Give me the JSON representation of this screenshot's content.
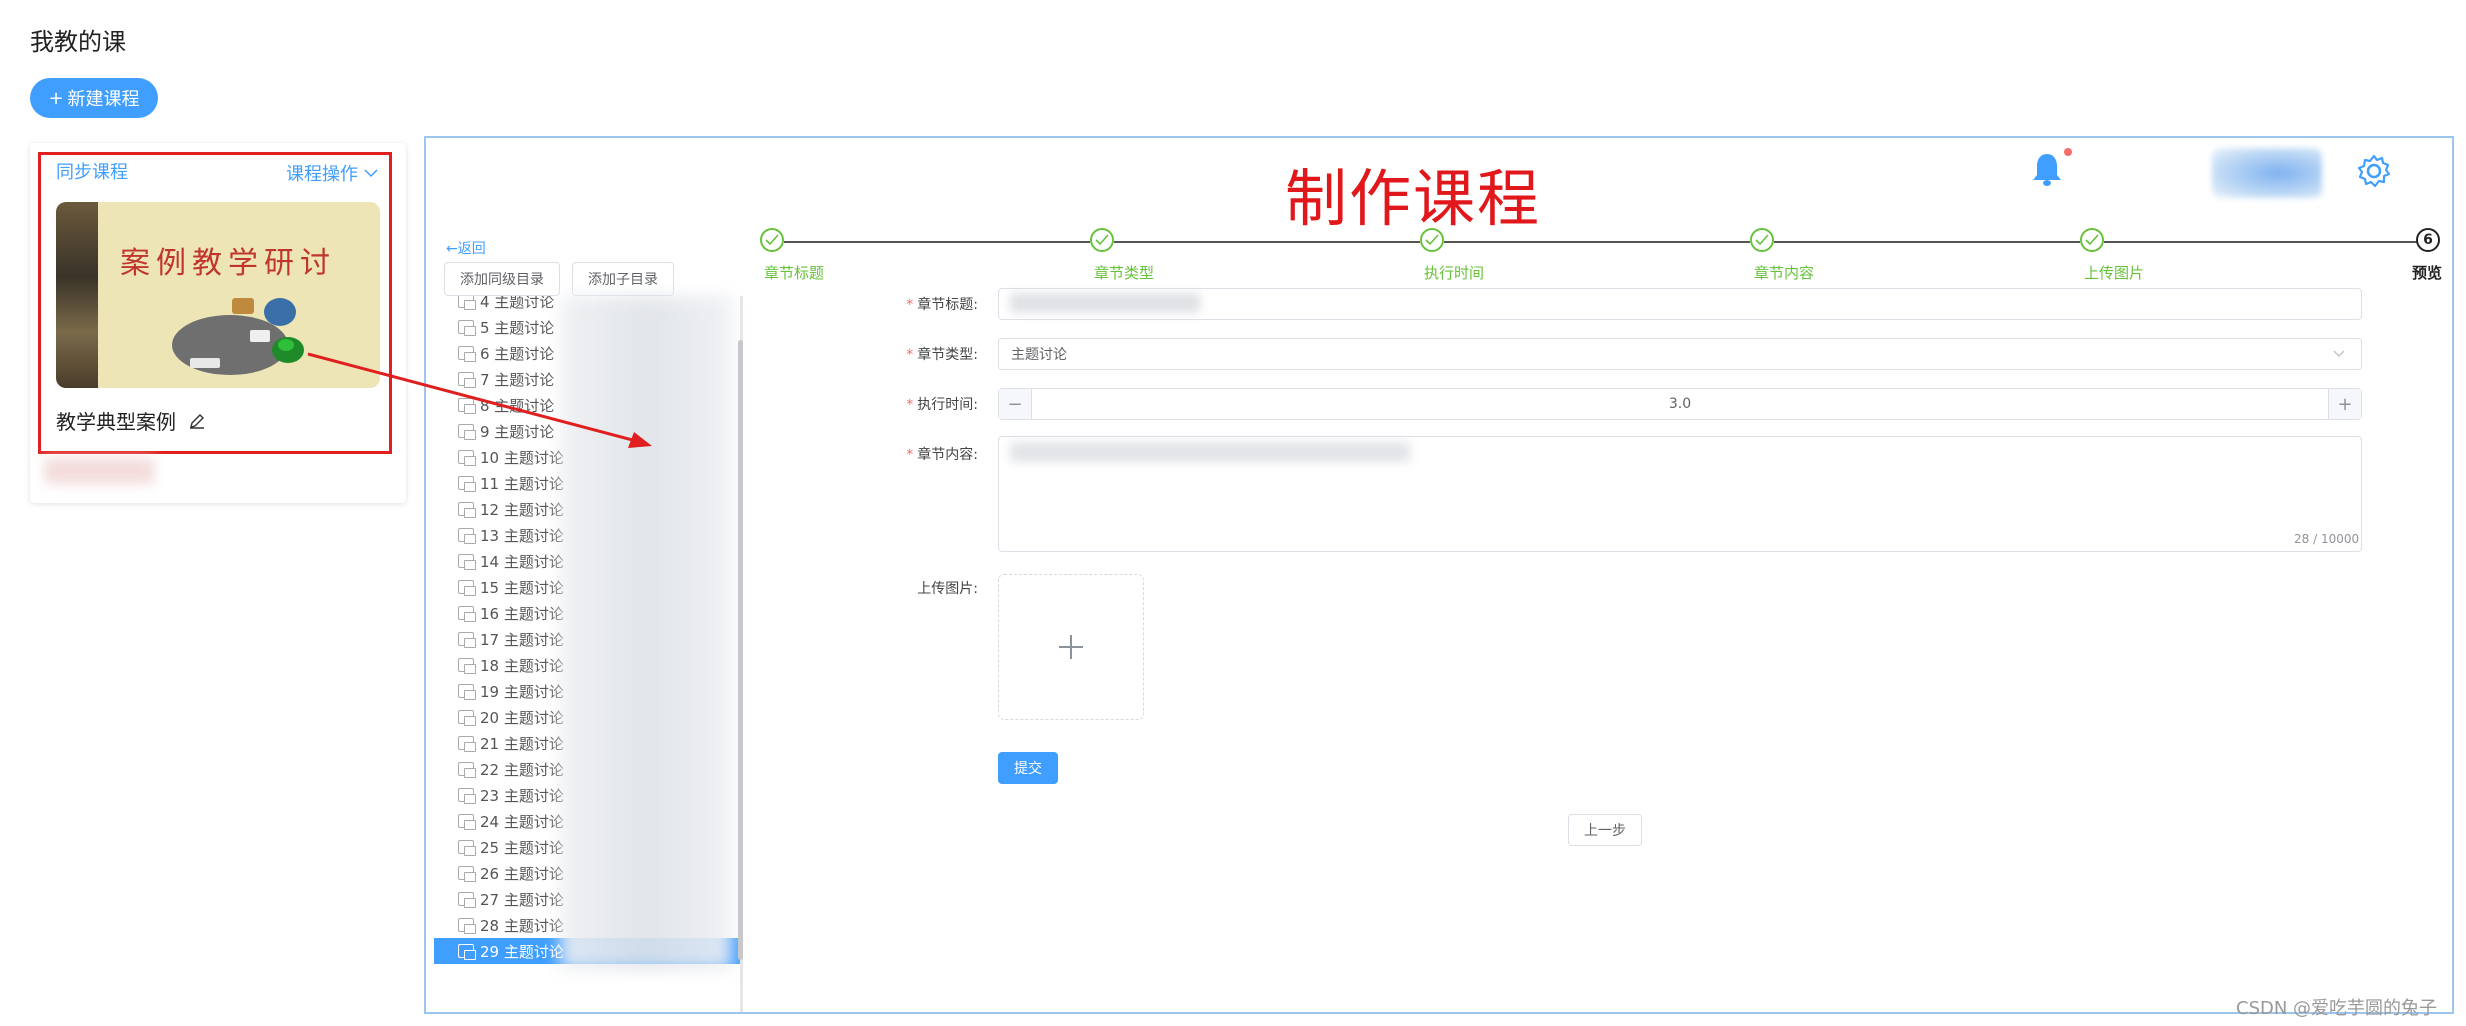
{
  "page": {
    "title": "我教的课",
    "new_course_label": "新建课程"
  },
  "course_card": {
    "sync_label": "同步课程",
    "ops_label": "课程操作",
    "cover_text": "案例教学研讨",
    "course_name": "教学典型案例"
  },
  "editor": {
    "big_title": "制作课程",
    "back_label": "返回",
    "add_sibling_label": "添加同级目录",
    "add_child_label": "添加子目录",
    "tree_items": [
      {
        "label": "4 主题讨论"
      },
      {
        "label": "5 主题讨论"
      },
      {
        "label": "6 主题讨论"
      },
      {
        "label": "7 主题讨论"
      },
      {
        "label": "8 主题讨论"
      },
      {
        "label": "9 主题讨论"
      },
      {
        "label": "10 主题讨论"
      },
      {
        "label": "11 主题讨论"
      },
      {
        "label": "12 主题讨论"
      },
      {
        "label": "13 主题讨论"
      },
      {
        "label": "14 主题讨论"
      },
      {
        "label": "15 主题讨论"
      },
      {
        "label": "16 主题讨论"
      },
      {
        "label": "17 主题讨论"
      },
      {
        "label": "18 主题讨论"
      },
      {
        "label": "19 主题讨论"
      },
      {
        "label": "20 主题讨论"
      },
      {
        "label": "21 主题讨论"
      },
      {
        "label": "22 主题讨论"
      },
      {
        "label": "23 主题讨论"
      },
      {
        "label": "24 主题讨论"
      },
      {
        "label": "25 主题讨论"
      },
      {
        "label": "26 主题讨论"
      },
      {
        "label": "27 主题讨论"
      },
      {
        "label": "28 主题讨论"
      },
      {
        "label": "29 主题讨论",
        "selected": true
      }
    ],
    "steps": [
      {
        "label": "章节标题",
        "status": "done"
      },
      {
        "label": "章节类型",
        "status": "done"
      },
      {
        "label": "执行时间",
        "status": "done"
      },
      {
        "label": "章节内容",
        "status": "done"
      },
      {
        "label": "上传图片",
        "status": "done"
      },
      {
        "label": "预览",
        "status": "current",
        "number": "6"
      }
    ],
    "form": {
      "title_label": "章节标题:",
      "type_label": "章节类型:",
      "type_value": "主题讨论",
      "time_label": "执行时间:",
      "time_value": "3.0",
      "content_label": "章节内容:",
      "content_count": "28 / 10000",
      "upload_label": "上传图片:",
      "submit_label": "提交",
      "prev_label": "上一步"
    }
  },
  "watermark": "CSDN @爱吃芋圆的兔子",
  "colors": {
    "primary": "#409eff",
    "success": "#67c23a",
    "annotation_red": "#e02020",
    "danger_dot": "#f56c6c"
  }
}
